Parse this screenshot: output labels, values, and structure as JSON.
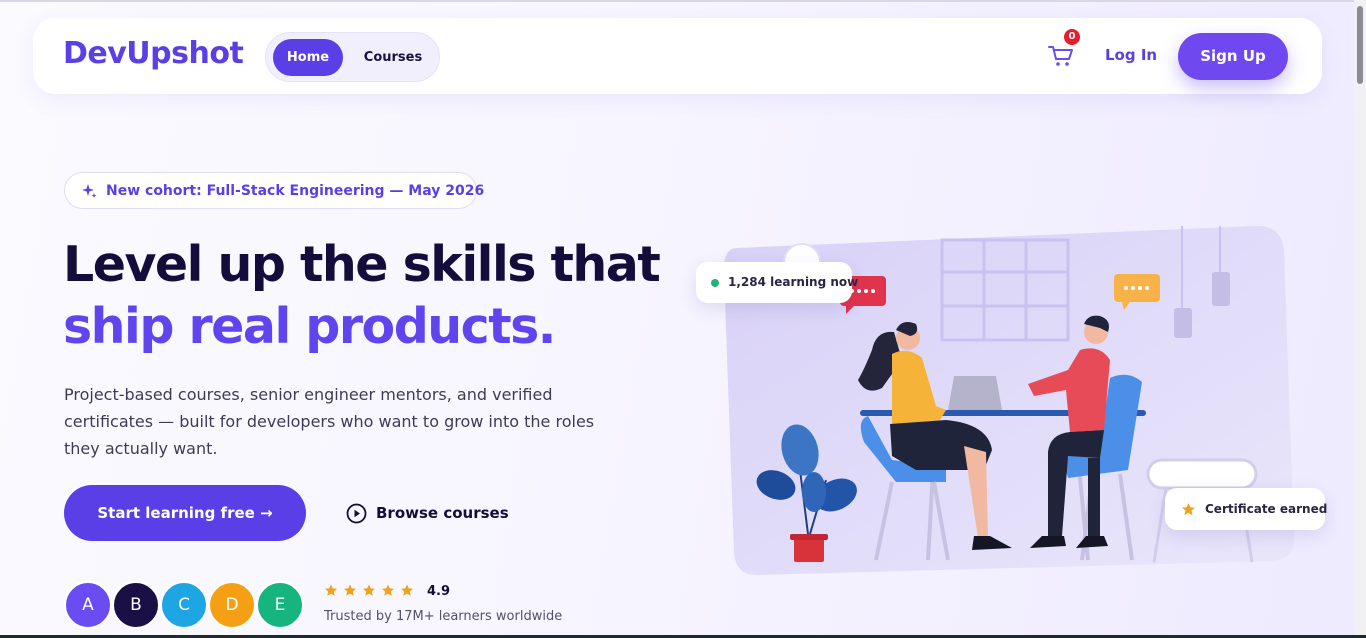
{
  "header": {
    "brand": "DevUpshot",
    "nav": [
      {
        "label": "Home",
        "active": true
      },
      {
        "label": "Courses",
        "active": false
      }
    ],
    "cart_count": "0",
    "login_label": "Log In",
    "signup_label": "Sign Up"
  },
  "hero": {
    "badge": "New cohort: Full-Stack Engineering — May 2026",
    "title_line1": "Level up the skills that",
    "title_line2": "ship real products.",
    "lead": "Project-based courses, senior engineer mentors, and verified certificates — built for developers who want to grow into the roles they actually want.",
    "primary_cta": "Start learning free →",
    "secondary_cta": "Browse courses",
    "avatars": [
      {
        "letter": "A",
        "color": "#6a4cf2"
      },
      {
        "letter": "B",
        "color": "#1b1046"
      },
      {
        "letter": "C",
        "color": "#1ea5e4"
      },
      {
        "letter": "D",
        "color": "#f5a014"
      },
      {
        "letter": "E",
        "color": "#16b57f"
      }
    ],
    "rating": "4.9",
    "stars": 5,
    "trusted": "Trusted by 17M+ learners worldwide"
  },
  "illustration": {
    "live_badge": "1,284 learning now",
    "cert_badge": "Certificate earned"
  },
  "colors": {
    "brand": "#5b3fe6",
    "accent_light": "#7048f0",
    "heading_dark": "#140c3a",
    "star": "#f0a21b",
    "live_dot": "#1fb27a",
    "badge_red": "#e81c2c"
  }
}
